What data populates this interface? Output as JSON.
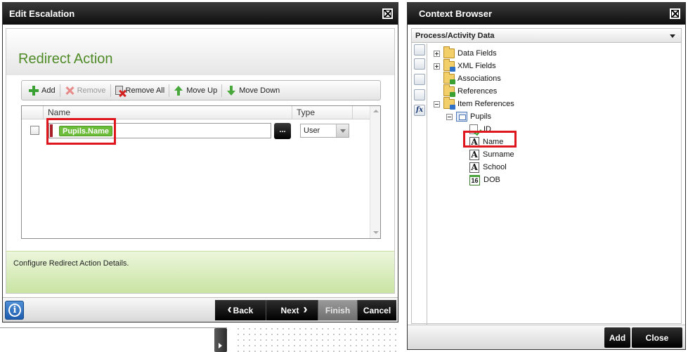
{
  "edit_dialog": {
    "title": "Edit Escalation",
    "page_title": "Redirect Action",
    "toolbar": {
      "add": "Add",
      "remove": "Remove",
      "remove_all": "Remove All",
      "move_up": "Move Up",
      "move_down": "Move Down"
    },
    "grid": {
      "columns": [
        "Name",
        "Type"
      ],
      "rows": [
        {
          "name_token": "Pupils.Name",
          "ellipsis": "...",
          "type": "User"
        }
      ]
    },
    "info_text": "Configure Redirect Action Details.",
    "footer": {
      "info_icon": "i",
      "back": "Back",
      "next": "Next",
      "finish": "Finish",
      "cancel": "Cancel"
    }
  },
  "context_browser": {
    "title": "Context Browser",
    "dropdown": "Process/Activity Data",
    "tree": [
      {
        "label": "Data Fields",
        "icon": "folder-icon",
        "expander": "plus"
      },
      {
        "label": "XML Fields",
        "icon": "folder-icon",
        "expander": "plus"
      },
      {
        "label": "Associations",
        "icon": "folder-icon",
        "expander": "none"
      },
      {
        "label": "References",
        "icon": "folder-icon",
        "expander": "none"
      },
      {
        "label": "Item References",
        "icon": "folder-icon",
        "expander": "minus"
      },
      {
        "label": "Pupils",
        "icon": "reference-icon",
        "expander": "minus"
      },
      {
        "label": "ID",
        "icon": "id-field-icon",
        "expander": "none"
      },
      {
        "label": "Name",
        "icon": "text-field-icon",
        "expander": "none"
      },
      {
        "label": "Surname",
        "icon": "text-field-icon",
        "expander": "none"
      },
      {
        "label": "School",
        "icon": "text-field-icon",
        "expander": "none"
      },
      {
        "label": "DOB",
        "icon": "date-field-icon",
        "expander": "none"
      }
    ],
    "text_icon_glyph": "A",
    "date_icon_glyph": "16",
    "side_tab_fx": "fx",
    "footer": {
      "add": "Add",
      "close": "Close"
    }
  },
  "colors": {
    "accent_green": "#4e8a25",
    "token_green": "#6cbd3a",
    "highlight_red": "#e0161f"
  }
}
